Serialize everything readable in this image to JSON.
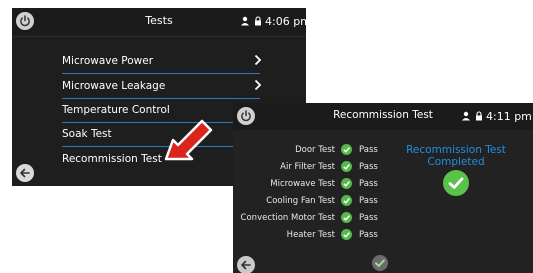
{
  "tests_screen": {
    "title": "Tests",
    "time": "4:06 pm",
    "menu_items": [
      {
        "label": "Microwave Power",
        "has_chevron": true
      },
      {
        "label": "Microwave Leakage",
        "has_chevron": true
      },
      {
        "label": "Temperature Control",
        "has_chevron": false
      },
      {
        "label": "Soak Test",
        "has_chevron": false
      },
      {
        "label": "Recommission Test",
        "has_chevron": false
      }
    ]
  },
  "recommission_screen": {
    "title": "Recommission Test",
    "time": "4:11 pm",
    "results": [
      {
        "name": "Door Test",
        "status": "Pass"
      },
      {
        "name": "Air Filter Test",
        "status": "Pass"
      },
      {
        "name": "Microwave Test",
        "status": "Pass"
      },
      {
        "name": "Cooling Fan Test",
        "status": "Pass"
      },
      {
        "name": "Convection Motor Test",
        "status": "Pass"
      },
      {
        "name": "Heater Test",
        "status": "Pass"
      }
    ],
    "completed_line1": "Recommission Test",
    "completed_line2": "Completed"
  },
  "icons": {
    "power": "power-icon",
    "user": "user-icon",
    "lock": "lock-icon",
    "back": "back-arrow-icon",
    "chevron": "chevron-right-icon",
    "check": "check-icon",
    "pointer": "red-arrow-icon"
  },
  "colors": {
    "accent_blue": "#1f8fe0",
    "underline_blue": "#2f78c0",
    "pass_green": "#55b84a",
    "pointer_red": "#d9251c"
  }
}
